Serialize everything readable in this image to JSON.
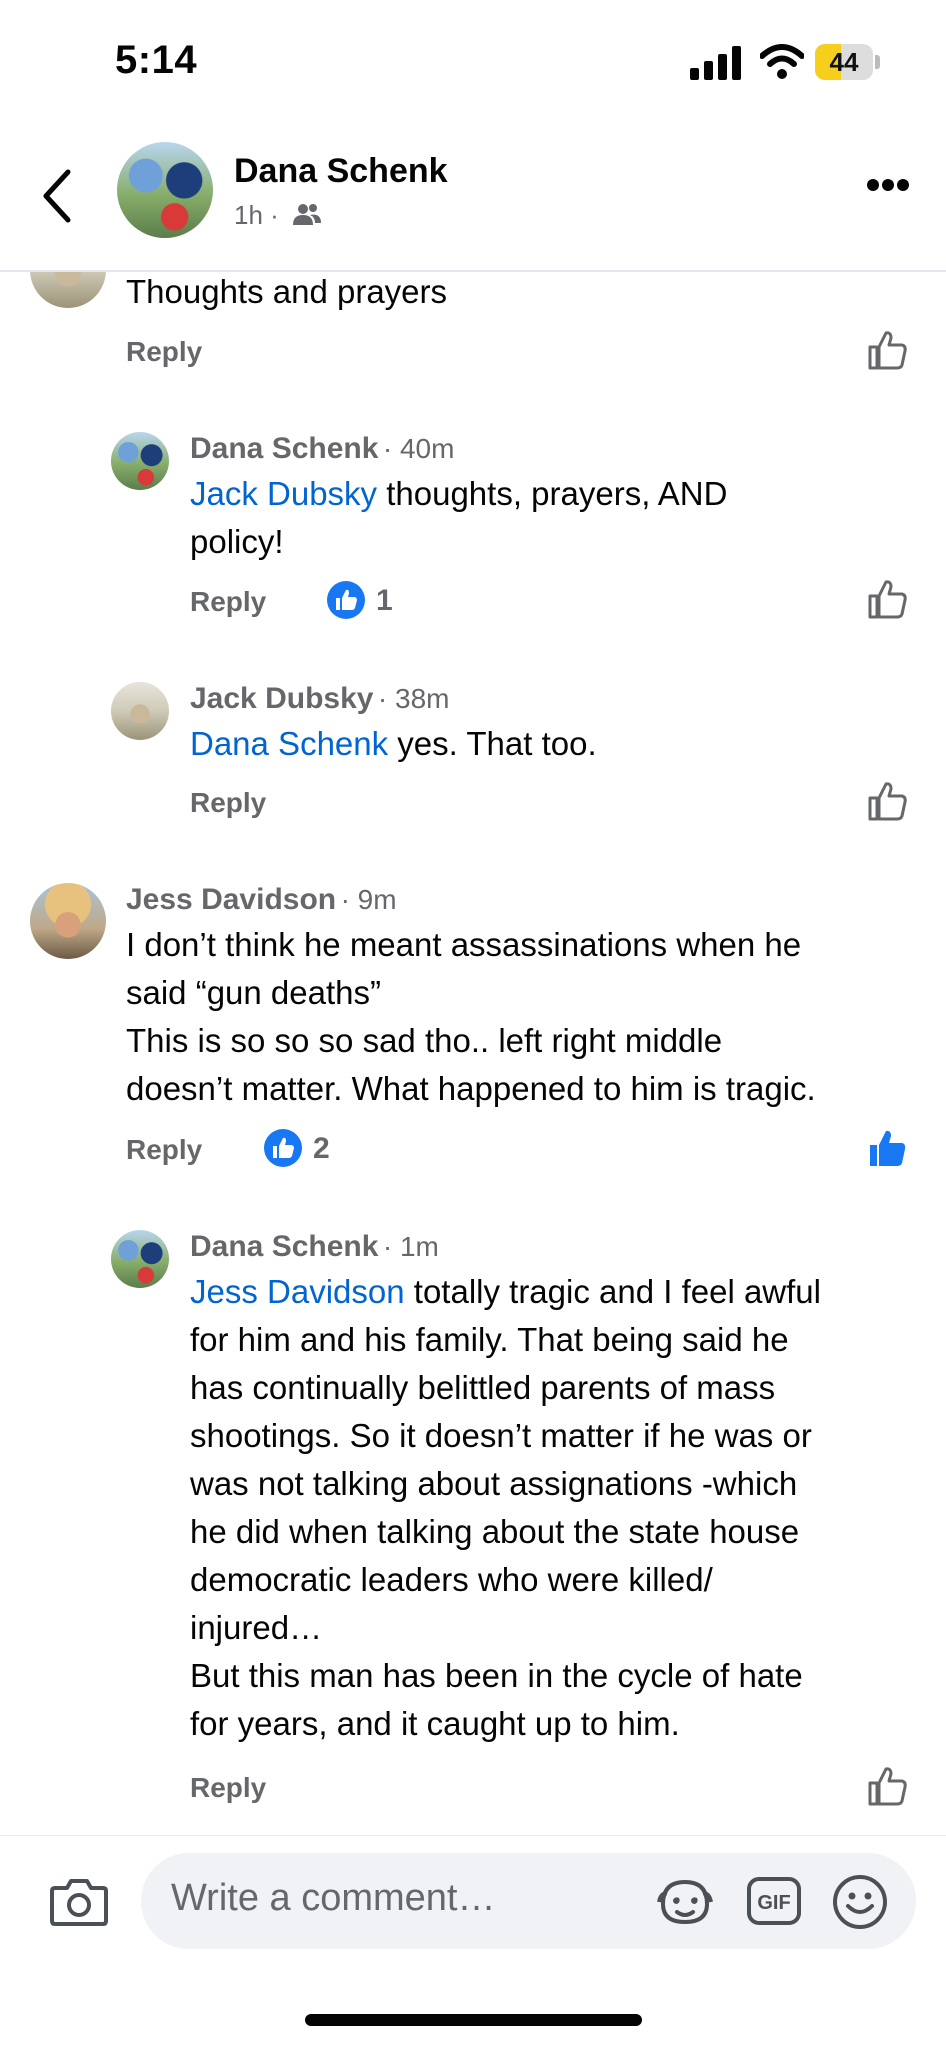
{
  "status_bar": {
    "time": "5:14",
    "battery_level": "44",
    "battery_fraction": 0.44
  },
  "header": {
    "author": "Dana Schenk",
    "meta": "1h ·",
    "audience_icon": "friends-icon",
    "more_icon": "more-horizontal-icon",
    "back_icon": "chevron-left-icon"
  },
  "comments": [
    {
      "text": "Thoughts and prayers",
      "reply": "Reply"
    },
    {
      "name": "Dana Schenk",
      "time": "· 40m",
      "mention": "Jack Dubsky",
      "text_line1": " thoughts, prayers, AND",
      "text_line2": "policy!",
      "reply": "Reply",
      "likes": "1"
    },
    {
      "name": "Jack Dubsky",
      "time": "· 38m",
      "mention": "Dana Schenk",
      "text": " yes. That too.",
      "reply": "Reply"
    },
    {
      "name": "Jess Davidson",
      "time": "· 9m",
      "lines": [
        "I don’t think he meant assassinations when he",
        "said “gun deaths”",
        "This is so so so sad tho.. left right middle",
        "doesn’t matter. What happened to him is tragic."
      ],
      "reply": "Reply",
      "likes": "2"
    },
    {
      "name": "Dana Schenk",
      "time": "· 1m",
      "mention": "Jess Davidson",
      "first_line_rest": " totally tragic and I feel awful",
      "lines": [
        "for him and his family. That being said he",
        "has continually belittled parents of mass",
        "shootings.  So it doesn’t matter if he was or",
        "was not talking about assignations -which",
        "he did when talking about the state house",
        "democratic leaders who were killed/",
        "injured…",
        "But this man has been in the cycle of hate",
        "for years, and it caught up to him."
      ],
      "reply": "Reply"
    }
  ],
  "composer": {
    "placeholder": "Write a comment…",
    "icons": [
      "camera-icon",
      "avatar-sticker-icon",
      "gif-icon",
      "emoji-icon"
    ]
  },
  "colors": {
    "link": "#0064d1",
    "like_blue": "#1877f2",
    "secondary_text": "#65676b",
    "battery": "#f5cf1b"
  }
}
